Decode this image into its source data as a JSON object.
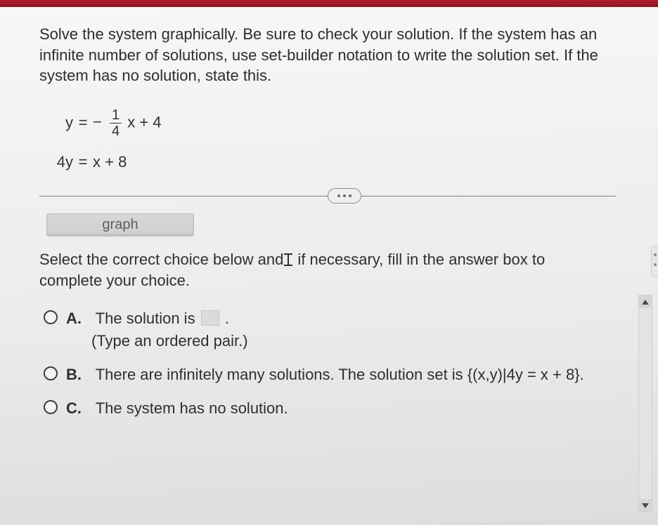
{
  "question": "Solve the system graphically. Be sure to check your solution. If the system has an infinite number of solutions, use set-builder notation to write the solution set. If the system has no solution, state this.",
  "equations": {
    "eq1": {
      "lhs": "y",
      "rhs_prefix": "−",
      "frac_num": "1",
      "frac_den": "4",
      "rhs_suffix": "x + 4"
    },
    "eq2": {
      "lhs": "4y",
      "rhs": "x + 8"
    }
  },
  "tab_label": "graph",
  "instruction_before": "Select the correct choice below and",
  "instruction_after": " if necessary, fill in the answer box to complete your choice.",
  "choices": {
    "A": {
      "letter": "A.",
      "text_before": "The solution is ",
      "text_after": ".",
      "hint": "(Type an ordered pair.)"
    },
    "B": {
      "letter": "B.",
      "text": "There are infinitely many solutions. The solution set is {(x,y)|4y = x + 8}."
    },
    "C": {
      "letter": "C.",
      "text": "The system has no solution."
    }
  }
}
